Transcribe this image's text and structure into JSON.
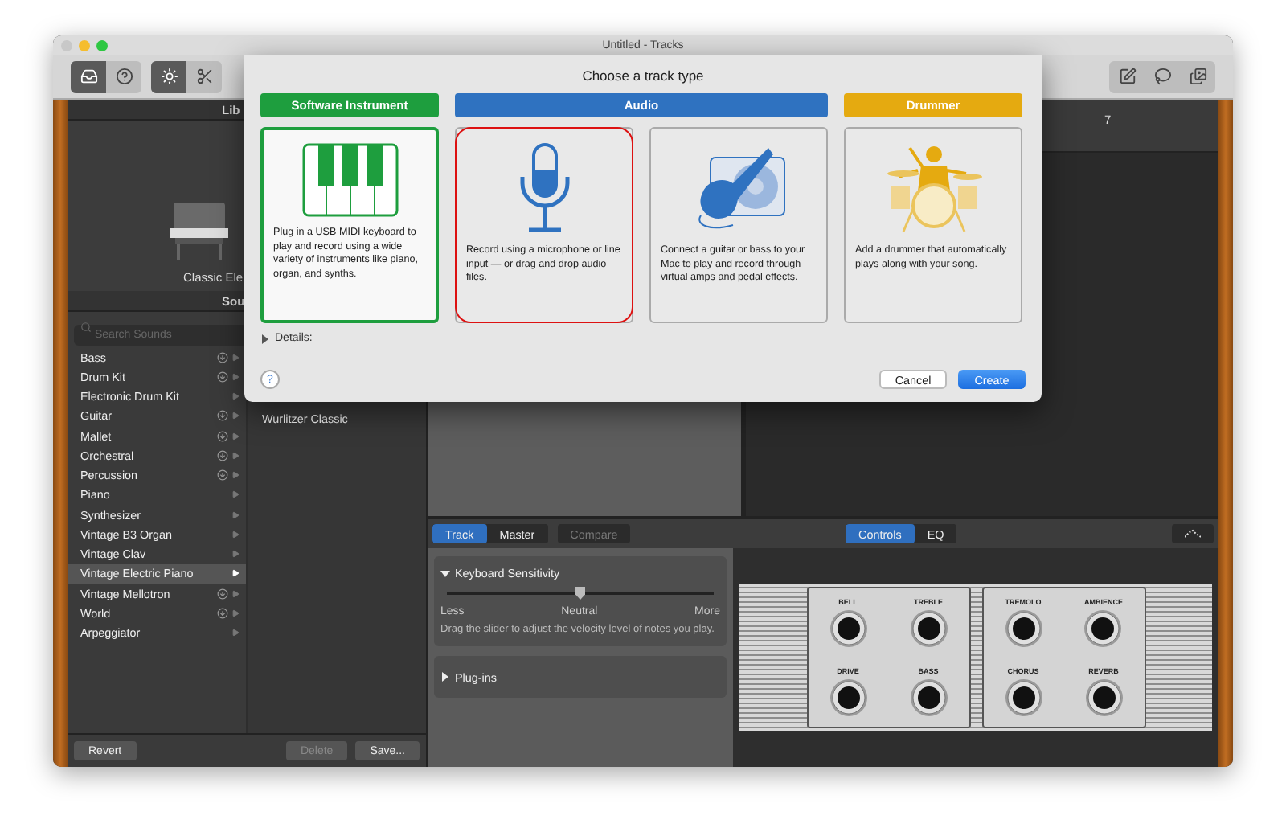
{
  "window": {
    "title": "Untitled - Tracks"
  },
  "library": {
    "header": "Lib",
    "patch_name": "Classic Ele",
    "sounds_header": "Sou",
    "search": {
      "placeholder": "Search Sounds"
    },
    "categories": [
      {
        "label": "Bass",
        "download": true,
        "selected": false
      },
      {
        "label": "Drum Kit",
        "download": true,
        "selected": false
      },
      {
        "label": "Electronic Drum Kit",
        "download": false,
        "selected": false
      },
      {
        "label": "Guitar",
        "download": true,
        "selected": false
      },
      {
        "label": "Mallet",
        "download": true,
        "selected": false
      },
      {
        "label": "Orchestral",
        "download": true,
        "selected": false
      },
      {
        "label": "Percussion",
        "download": true,
        "selected": false
      },
      {
        "label": "Piano",
        "download": false,
        "selected": false
      },
      {
        "label": "Synthesizer",
        "download": false,
        "selected": false
      },
      {
        "label": "Vintage B3 Organ",
        "download": false,
        "selected": false
      },
      {
        "label": "Vintage Clav",
        "download": false,
        "selected": false
      },
      {
        "label": "Vintage Electric Piano",
        "download": false,
        "selected": true
      },
      {
        "label": "Vintage Mellotron",
        "download": true,
        "selected": false
      },
      {
        "label": "World",
        "download": true,
        "selected": false
      },
      {
        "label": "Arpeggiator",
        "download": false,
        "selected": false
      }
    ],
    "sounds": [
      {
        "label": "Wurlitzer Classic"
      }
    ],
    "buttons": [
      {
        "label": "Revert",
        "disabled": false
      },
      {
        "label": "Delete",
        "disabled": true
      },
      {
        "label": "Save...",
        "disabled": false
      }
    ]
  },
  "ruler": {
    "bar": "7"
  },
  "smart_controls": {
    "tabs": [
      {
        "label": "Track",
        "selected": true
      },
      {
        "label": "Master",
        "selected": false
      }
    ],
    "compare": {
      "label": "Compare",
      "disabled": true
    },
    "view_tabs": [
      {
        "label": "Controls",
        "selected": true
      },
      {
        "label": "EQ",
        "selected": false
      }
    ],
    "sensitivity": {
      "title": "Keyboard Sensitivity",
      "expanded": true,
      "level": 0.5,
      "labels": [
        "Less",
        "Neutral",
        "More"
      ],
      "hint": "Drag the slider to adjust the velocity level of notes you play."
    },
    "plugins": {
      "title": "Plug-ins",
      "expanded": false
    },
    "knob_panels": [
      {
        "knobs": [
          {
            "label": "BELL"
          },
          {
            "label": "TREBLE"
          },
          {
            "label": "DRIVE"
          },
          {
            "label": "BASS"
          }
        ]
      },
      {
        "knobs": [
          {
            "label": "TREMOLO"
          },
          {
            "label": "AMBIENCE"
          },
          {
            "label": "CHORUS"
          },
          {
            "label": "REVERB"
          }
        ]
      }
    ]
  },
  "dialog": {
    "title": "Choose a track type",
    "categories": [
      {
        "label": "Software Instrument",
        "color": "#1e9e3e",
        "cards": [
          {
            "kind": "keyboard",
            "text": "Plug in a USB MIDI keyboard to play and record using a wide variety of instruments like piano, organ, and synths.",
            "selected": true,
            "highlighted": false
          }
        ]
      },
      {
        "label": "Audio",
        "color": "#2f72c0",
        "cards": [
          {
            "kind": "microphone",
            "text": "Record using a microphone or line input — or drag and drop audio files.",
            "selected": false,
            "highlighted": true
          },
          {
            "kind": "guitar",
            "text": "Connect a guitar or bass to your Mac to play and record through virtual amps and pedal effects.",
            "selected": false,
            "highlighted": false
          }
        ]
      },
      {
        "label": "Drummer",
        "color": "#e5aa10",
        "cards": [
          {
            "kind": "drummer",
            "text": "Add a drummer that automatically plays along with your song.",
            "selected": false,
            "highlighted": false
          }
        ]
      }
    ],
    "details": {
      "label": "Details:",
      "expanded": false
    },
    "help": "?",
    "buttons": [
      {
        "label": "Cancel",
        "kind": "default"
      },
      {
        "label": "Create",
        "kind": "primary"
      }
    ]
  }
}
